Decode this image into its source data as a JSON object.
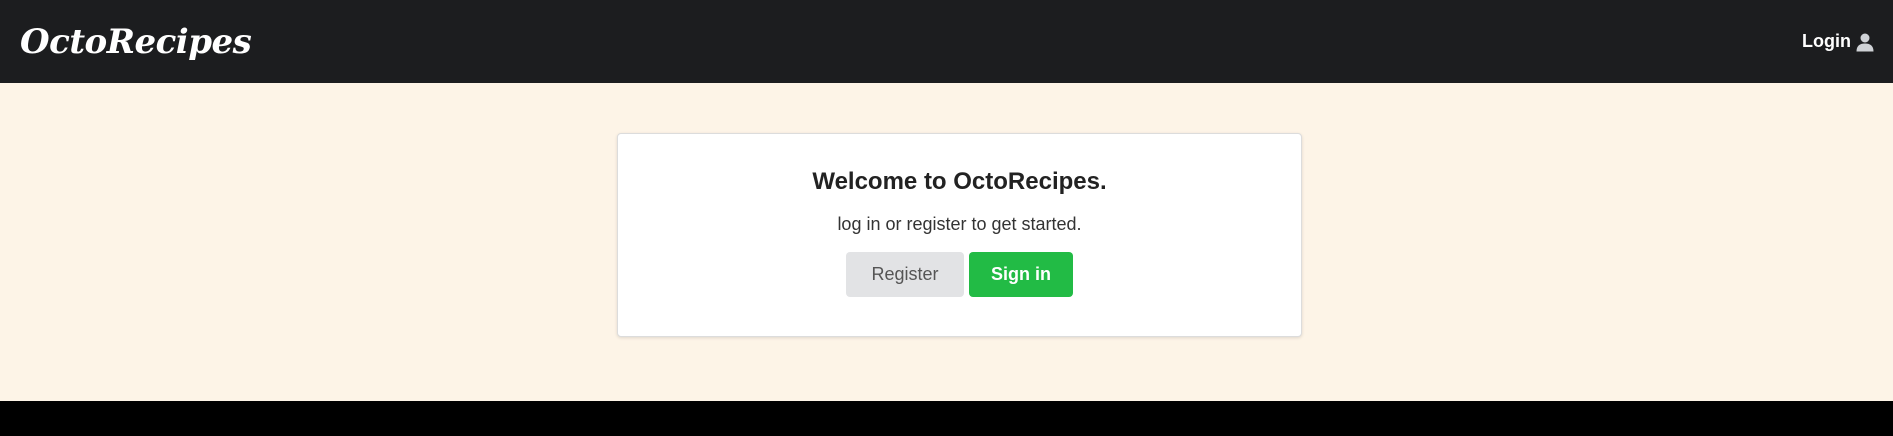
{
  "navbar": {
    "brand": "OctoRecipes",
    "login_label": "Login",
    "login_icon": "user-icon"
  },
  "welcome": {
    "title": "Welcome to OctoRecipes.",
    "subtitle": "log in or register to get started.",
    "register_label": "Register",
    "signin_label": "Sign in"
  },
  "colors": {
    "navbar_bg": "#1c1d1f",
    "page_bg": "#fdf4e7",
    "signin_bg": "#22bb45",
    "register_bg": "#e2e3e5",
    "footer_bg": "#000000"
  }
}
